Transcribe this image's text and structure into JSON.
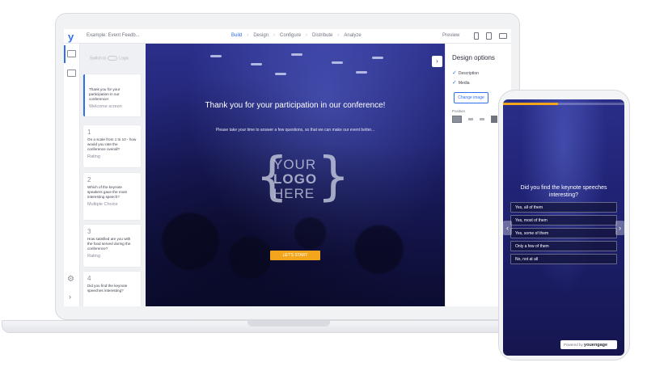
{
  "app": {
    "logo": "y",
    "doc_title": "Example: Event Feedb..."
  },
  "nav": {
    "tabs": [
      "Build",
      "Design",
      "Configure",
      "Distribute",
      "Analyze"
    ],
    "active": "Build",
    "preview_label": "Preview"
  },
  "sidebar": {
    "switch_label": "Switch to",
    "switch_logic": "Logic"
  },
  "questions": [
    {
      "num": "",
      "text": "Thank you for your participation in our conference!",
      "type": "Welcome screen"
    },
    {
      "num": "1",
      "text": "On a scale from 1 to 10 - how would you rate the conference overall?",
      "type": "Rating"
    },
    {
      "num": "2",
      "text": "Which of the keynote speakers gave the most interesting speech?",
      "type": "Multiple Choice"
    },
    {
      "num": "3",
      "text": "How satisfied are you with the food served during the conference?",
      "type": "Rating"
    },
    {
      "num": "4",
      "text": "Did you find the keynote speeches interesting?",
      "type": ""
    }
  ],
  "canvas": {
    "title": "Thank you for your participation in our conference!",
    "description": "Please take your time to answer a few questions, so that we can make our event better...",
    "logo_line1": "YOUR",
    "logo_line2": "LOGO",
    "logo_line3": "HERE",
    "start_label": "LET'S START"
  },
  "design_panel": {
    "title": "Design options",
    "description_label": "Description",
    "media_label": "Media",
    "change_image_label": "Change image",
    "position_label": "Position"
  },
  "phone": {
    "question": "Did you find the keynote speeches interesting?",
    "options": [
      "Yes, all of them",
      "Yes, most of them",
      "Yes, some of them",
      "Only a few of them",
      "No, not at all"
    ],
    "progress": 0.45,
    "powered_by": "Powered by",
    "brand": "youengage"
  },
  "colors": {
    "accent": "#2f6fed",
    "button": "#f3a51c",
    "overlay": "#1e2070"
  }
}
